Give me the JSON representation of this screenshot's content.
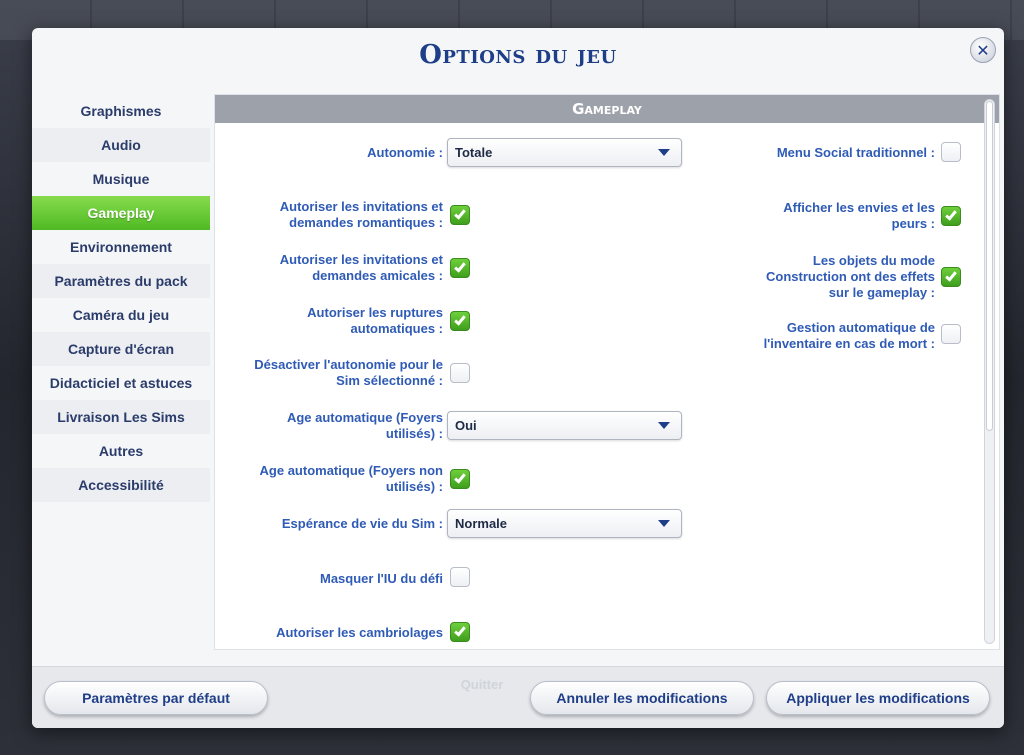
{
  "dialog": {
    "title": "Options du jeu",
    "close_icon": "✕"
  },
  "sidebar": {
    "items": [
      {
        "label": "Graphismes"
      },
      {
        "label": "Audio"
      },
      {
        "label": "Musique"
      },
      {
        "label": "Gameplay",
        "active": true
      },
      {
        "label": "Environnement"
      },
      {
        "label": "Paramètres du pack"
      },
      {
        "label": "Caméra du jeu"
      },
      {
        "label": "Capture d'écran"
      },
      {
        "label": "Didacticiel et astuces"
      },
      {
        "label": "Livraison Les Sims"
      },
      {
        "label": "Autres"
      },
      {
        "label": "Accessibilité"
      }
    ]
  },
  "panel": {
    "header": "Gameplay",
    "left_options": {
      "autonomie": {
        "label": "Autonomie :",
        "value": "Totale"
      },
      "romantic": {
        "label1": "Autoriser les invitations et",
        "label2": "demandes romantiques :",
        "checked": true
      },
      "friendly": {
        "label1": "Autoriser les invitations et",
        "label2": "demandes amicales :",
        "checked": true
      },
      "breakups": {
        "label1": "Autoriser les ruptures",
        "label2": "automatiques :",
        "checked": true
      },
      "disable_autonomy": {
        "label1": "Désactiver l'autonomie pour le",
        "label2": "Sim sélectionné :",
        "checked": false
      },
      "age_used": {
        "label1": "Age automatique (Foyers",
        "label2": "utilisés) :",
        "value": "Oui"
      },
      "age_unused": {
        "label1": "Age automatique (Foyers non",
        "label2": "utilisés) :",
        "checked": true
      },
      "lifespan": {
        "label": "Espérance de vie du Sim :",
        "value": "Normale"
      },
      "hide_challenge": {
        "label": "Masquer l'IU du défi",
        "checked": false
      },
      "burglaries": {
        "label": "Autoriser les cambriolages",
        "checked": true
      }
    },
    "right_options": {
      "social_menu": {
        "label": "Menu Social traditionnel :",
        "checked": false
      },
      "wants_fears": {
        "label1": "Afficher les envies et les",
        "label2": "peurs :",
        "checked": true
      },
      "build_effects": {
        "label1": "Les objets du mode",
        "label2": "Construction ont des effets",
        "label3": "sur le gameplay :",
        "checked": true
      },
      "inventory_death": {
        "label1": "Gestion automatique de",
        "label2": "l'inventaire en cas de mort :",
        "checked": false
      }
    }
  },
  "footer": {
    "defaults_label": "Paramètres par défaut",
    "cancel_label": "Annuler les modifications",
    "apply_label": "Appliquer les modifications",
    "ghost_label": "Quitter"
  },
  "colors": {
    "accent_green": "#5cc22b",
    "title_blue": "#1f3e88",
    "label_blue": "#2f5bb5"
  }
}
